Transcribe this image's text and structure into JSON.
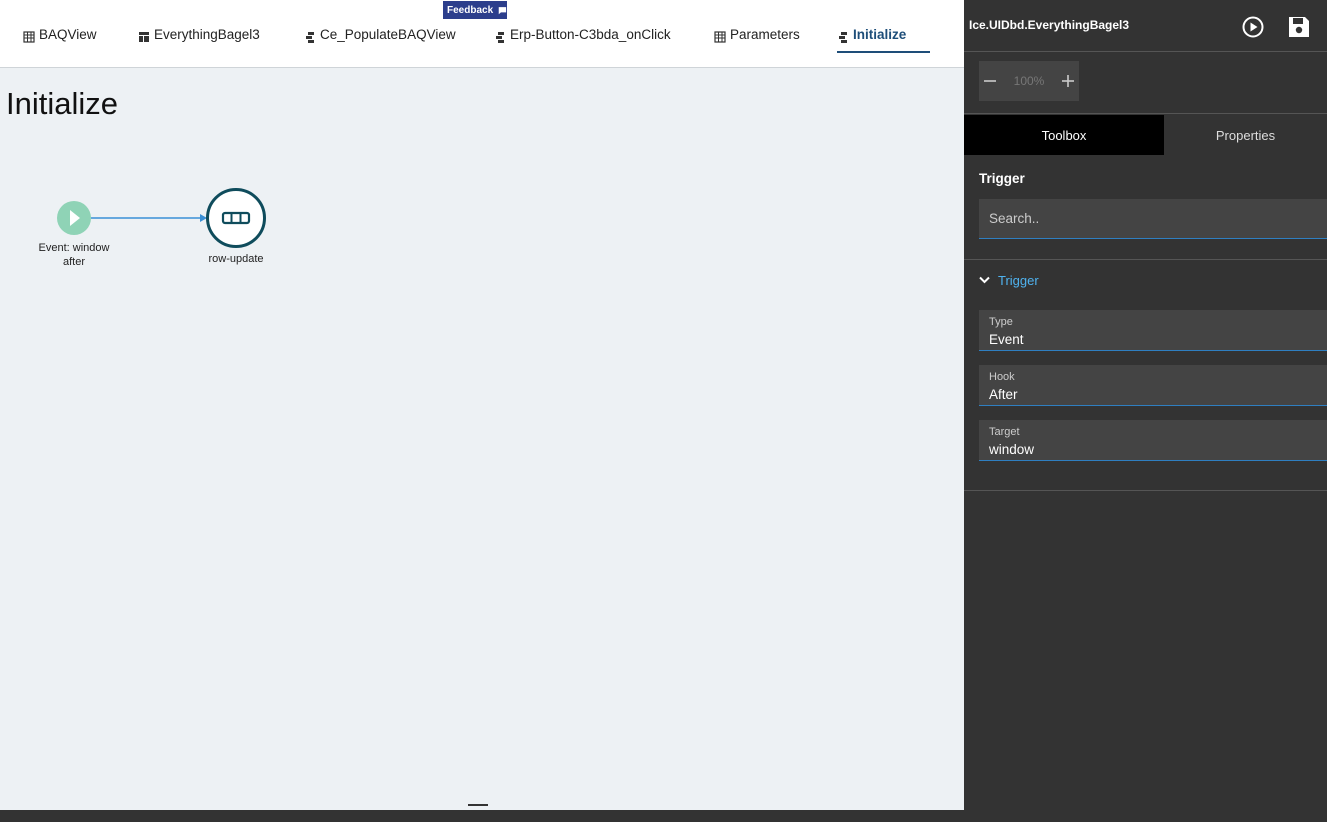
{
  "feedback": {
    "label": "Feedback"
  },
  "tabs": [
    {
      "label": "BAQView",
      "icon": "table-icon"
    },
    {
      "label": "EverythingBagel3",
      "icon": "layout-icon"
    },
    {
      "label": "Ce_PopulateBAQView",
      "icon": "event-icon"
    },
    {
      "label": "Erp-Button-C3bda_onClick",
      "icon": "event-icon"
    },
    {
      "label": "Parameters",
      "icon": "table-icon"
    },
    {
      "label": "Initialize",
      "icon": "event-icon",
      "active": true
    }
  ],
  "page": {
    "title": "Initialize"
  },
  "flow": {
    "start_node": {
      "label_line1": "Event: window",
      "label_line2": "after",
      "icon": "play-icon",
      "color": "#8fd3b6"
    },
    "action_node": {
      "label": "row-update",
      "icon": "row-update-icon",
      "color": "#0f4c5c"
    }
  },
  "panel": {
    "title": "Ice.UIDbd.EverythingBagel3",
    "zoom": {
      "value": "100%"
    },
    "tabs": {
      "toolbox": "Toolbox",
      "properties": "Properties"
    },
    "section_label": "Trigger",
    "search": {
      "placeholder": "Search.."
    },
    "group": {
      "label": "Trigger"
    },
    "fields": {
      "type": {
        "label": "Type",
        "value": "Event"
      },
      "hook": {
        "label": "Hook",
        "value": "After"
      },
      "target": {
        "label": "Target",
        "value": "window"
      }
    }
  },
  "colors": {
    "accent": "#2f7fc1",
    "link": "#4fb3f0",
    "active_tab": "#1e4e79",
    "panel_bg": "#333333"
  }
}
